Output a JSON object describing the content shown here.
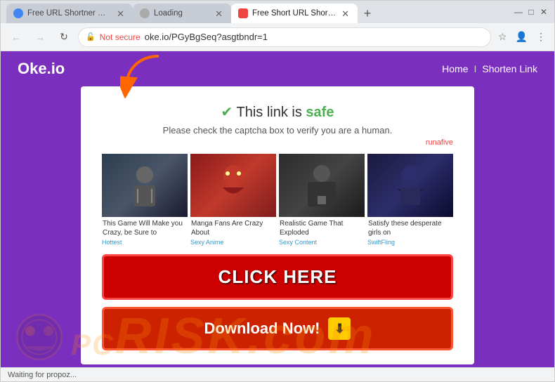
{
  "browser": {
    "tabs": [
      {
        "id": "tab1",
        "title": "Free URL Shortner Oke.io",
        "active": false,
        "favicon_color": "#4285f4"
      },
      {
        "id": "tab2",
        "title": "Loading",
        "active": false,
        "favicon_color": "#aaa"
      },
      {
        "id": "tab3",
        "title": "Free Short URL Shortner - Oke.io",
        "active": true,
        "favicon_color": "#e44"
      }
    ],
    "new_tab_label": "+",
    "address": {
      "security": "Not secure",
      "url": "oke.io/PGyBgSeq?asgtbndr=1"
    },
    "window_controls": [
      "—",
      "□",
      "✕"
    ]
  },
  "site": {
    "logo": "Oke.io",
    "nav": {
      "home": "Home",
      "separator": "I",
      "shorten": "Shorten Link"
    }
  },
  "card": {
    "safe_check": "✔",
    "safe_title_prefix": " This link is",
    "safe_title_highlight": "safe",
    "subtitle": "Please check the captcha box to verify you are a human.",
    "runafive": "runafive",
    "ads": [
      {
        "caption": "This Game Will Make you Crazy, be Sure to",
        "source": "Hottest"
      },
      {
        "caption": "Manga Fans Are Crazy About",
        "source": "Sexy Anime"
      },
      {
        "caption": "Realistic Game That Exploded",
        "source": "Sexy Content"
      },
      {
        "caption": "Satisfy these desperate girls on",
        "source": "SwiftFling"
      }
    ],
    "click_here": "CLICK HERE",
    "download_now": "Download Now!",
    "download_arrow": "⬇"
  },
  "watermark": {
    "text": "RISK.com"
  },
  "status": {
    "text": "Waiting for propoz..."
  }
}
